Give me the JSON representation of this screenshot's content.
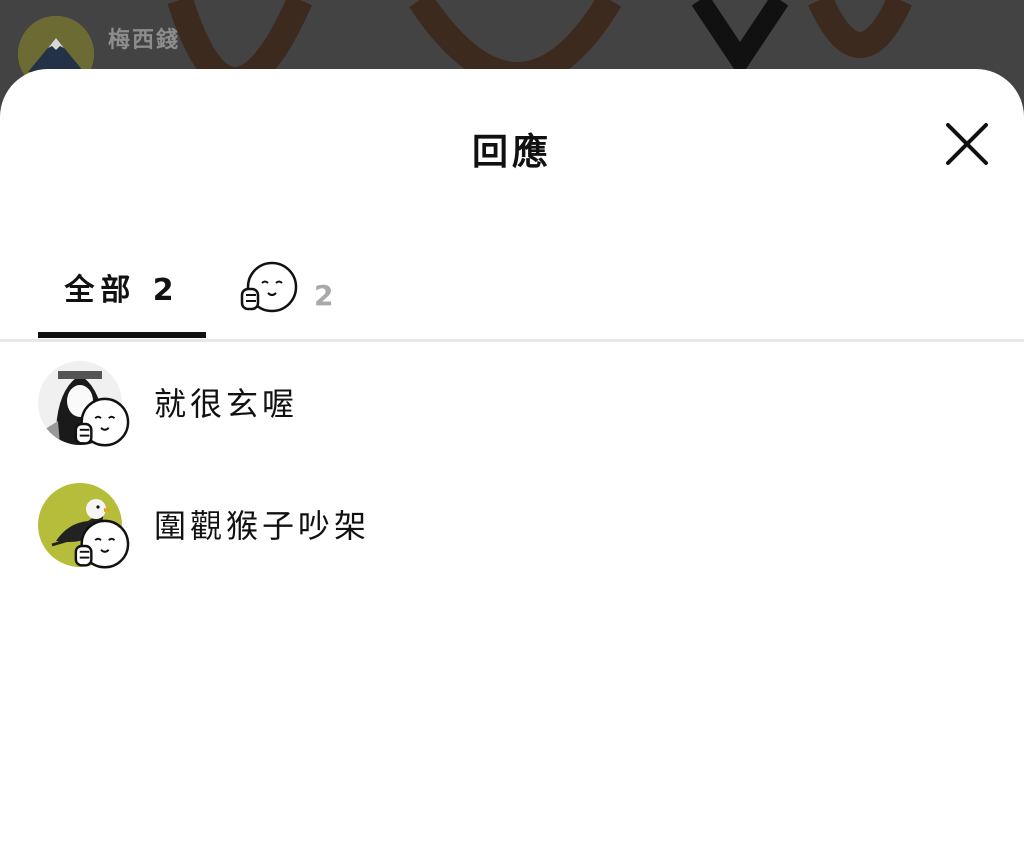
{
  "background_post": {
    "author_name": "梅西錢"
  },
  "sheet": {
    "title": "回應",
    "close_label": "close"
  },
  "tabs": {
    "all_label": "全部 2",
    "like_count": "2"
  },
  "reactions": [
    {
      "name": "就很玄喔",
      "reaction": "thumbs-up-face-icon"
    },
    {
      "name": "圍觀猴子吵架",
      "reaction": "thumbs-up-face-icon"
    }
  ],
  "colors": {
    "sheet_bg": "#ffffff",
    "text": "#111111",
    "muted_count": "#a9a9a9",
    "backdrop": "#434343",
    "bird_avatar_bg": "#b6bd3a"
  }
}
